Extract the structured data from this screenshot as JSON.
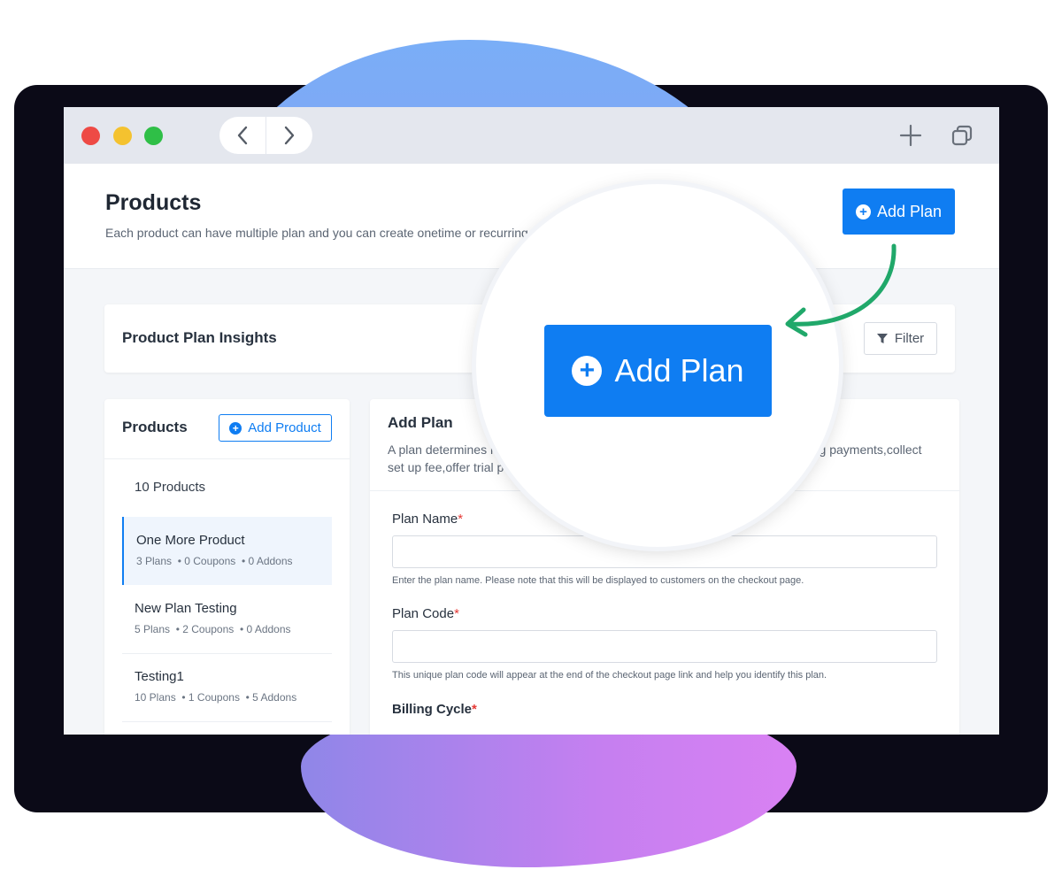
{
  "colors": {
    "primary": "#0f7df2",
    "required": "#e53935",
    "arrow": "#20a86a"
  },
  "window": {
    "titlebar": {
      "nav_back_icon": "chevron-left-icon",
      "nav_forward_icon": "chevron-right-icon",
      "new_tab_icon": "plus-icon",
      "copy_icon": "copy-icon"
    }
  },
  "header": {
    "title": "Products",
    "subtitle": "Each product can have multiple plan and you can create onetime or recurring p",
    "add_plan_label": "Add Plan"
  },
  "insights": {
    "title": "Product Plan Insights",
    "filter_label": "Filter"
  },
  "products_panel": {
    "title": "Products",
    "add_product_label": "Add Product",
    "count_text": "10 Products",
    "items": [
      {
        "name": "One More Product",
        "plans": "3 Plans",
        "coupons": "• 0 Coupons",
        "addons": "• 0 Addons"
      },
      {
        "name": "New Plan Testing",
        "plans": "5 Plans",
        "coupons": "• 2 Coupons",
        "addons": "• 0 Addons"
      },
      {
        "name": "Testing1",
        "plans": "10 Plans",
        "coupons": "• 1 Coupons",
        "addons": "• 5 Addons"
      }
    ]
  },
  "form": {
    "title": "Add Plan",
    "desc_left_1": "A plan determines ho",
    "desc_right_1": "ring payments,collect",
    "desc_left_2": "set up fee,offer trial pe",
    "fields": [
      {
        "label": "Plan Name",
        "help": "Enter the plan name. Please note that this will be displayed to customers on the checkout page."
      },
      {
        "label": "Plan Code",
        "help": "This unique plan code will appear at the end of the checkout page link and help you identify this plan."
      },
      {
        "label": "Billing Cycle"
      }
    ],
    "required_mark": "*"
  },
  "magnifier": {
    "button_label": "Add Plan"
  }
}
